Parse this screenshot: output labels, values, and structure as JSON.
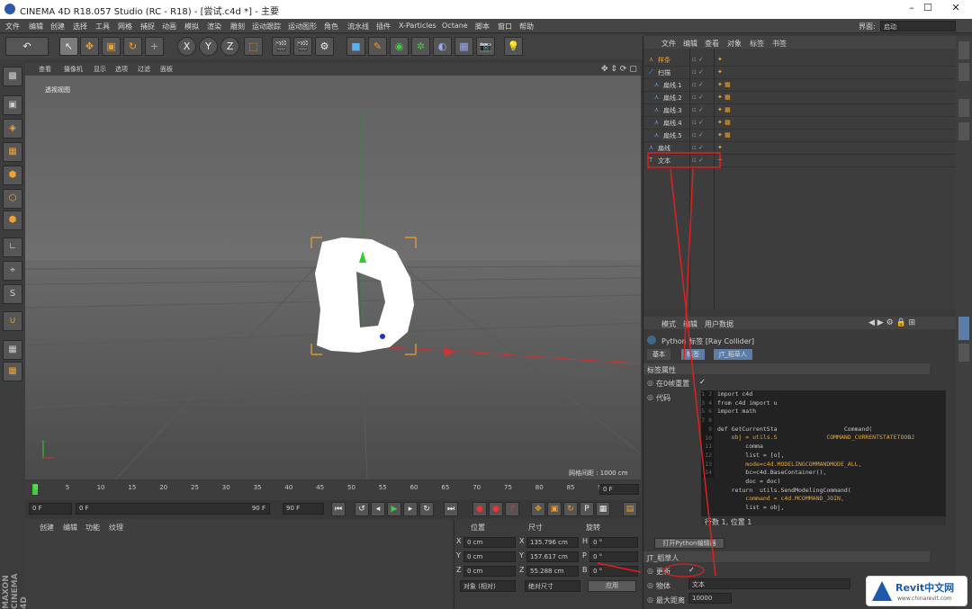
{
  "window": {
    "title": "CINEMA 4D R18.057 Studio (RC - R18) - [尝试.c4d *] - 主要",
    "controls": [
      "–",
      "☐",
      "✕"
    ]
  },
  "menu": [
    "文件",
    "编辑",
    "创建",
    "选择",
    "工具",
    "网格",
    "捕捉",
    "动画",
    "模拟",
    "渲染",
    "雕刻",
    "运动跟踪",
    "运动图形",
    "角色",
    "流水线",
    "插件",
    "X-Particles",
    "Octane",
    "脚本",
    "窗口",
    "帮助"
  ],
  "layout": {
    "label": "界面:",
    "value": "启动"
  },
  "viewport": {
    "menu": [
      "查看",
      "摄像机",
      "显示",
      "选项",
      "过滤",
      "面板"
    ],
    "label": "透视视图",
    "grid": "网格间距 : 1000 cm"
  },
  "timeline": {
    "ticks": [
      "0",
      "5",
      "10",
      "15",
      "20",
      "25",
      "30",
      "35",
      "40",
      "45",
      "50",
      "55",
      "60",
      "65",
      "70",
      "75",
      "80",
      "85",
      "90"
    ],
    "current": "0 F",
    "start": "0 F",
    "slider_start": "0 F",
    "slider_end": "90 F",
    "end": "90 F"
  },
  "materials": {
    "menu": [
      "创建",
      "编辑",
      "功能",
      "纹理"
    ]
  },
  "coords": {
    "headers": [
      "位置",
      "尺寸",
      "旋转"
    ],
    "rows": [
      {
        "a": "X",
        "pos": "0 cm",
        "b": "X",
        "size": "135.796 cm",
        "c": "H",
        "rot": "0 °"
      },
      {
        "a": "Y",
        "pos": "0 cm",
        "b": "Y",
        "size": "157.617 cm",
        "c": "P",
        "rot": "0 °"
      },
      {
        "a": "Z",
        "pos": "0 cm",
        "b": "Z",
        "size": "55.288 cm",
        "c": "B",
        "rot": "0 °"
      }
    ],
    "mode": "对象 (相对)",
    "size_mode": "绝对尺寸",
    "apply": "应用"
  },
  "objects": {
    "menu": [
      "文件",
      "编辑",
      "查看",
      "对象",
      "标签",
      "书签"
    ],
    "items": [
      "样条",
      "扫描",
      "扁线.1",
      "扁线.2",
      "扁线.3",
      "扁线.4",
      "扁线.5",
      "扁线",
      "文本"
    ]
  },
  "attributes": {
    "menu": [
      "模式",
      "编辑",
      "用户数据"
    ],
    "tag_title": "Python 标签 [Ray Collider]",
    "tabs": [
      "基本",
      "标签",
      "JT_稻草人"
    ],
    "section": "标签属性",
    "enable_label": "在0帧重置",
    "code_label": "代码",
    "code_lines": [
      "import c4d",
      "from c4d import u",
      "import math",
      "",
      "def GetCurrentSta                   Command(",
      "    obj = utils.S              COMMAND_CURRENTSTATETOOBJ",
      "        comma",
      "        list = [o],",
      "        mode=c4d.MODELINGCOMMANDMODE_ALL,",
      "        bc=c4d.BaseContainer(),",
      "        doc = doc)",
      "    return  utils.SendModelingCommand(",
      "        command = c4d.MCOMMAND_JOIN,",
      "        list = obj,"
    ],
    "cursor": "行数 1, 位置 1",
    "open_editor": "打开Python编辑器",
    "user_section": "JT_稻草人",
    "refresh_label": "更新",
    "object_label": "物体",
    "object_value": "文本",
    "max_label": "最大距离",
    "max_value": "10000"
  },
  "watermark": {
    "brand": "Revit中文网",
    "url": "www.chinarevit.com"
  },
  "colors": {
    "accent": "#f0a030",
    "bg": "#3a3a3a",
    "red_line": "#e02020"
  }
}
